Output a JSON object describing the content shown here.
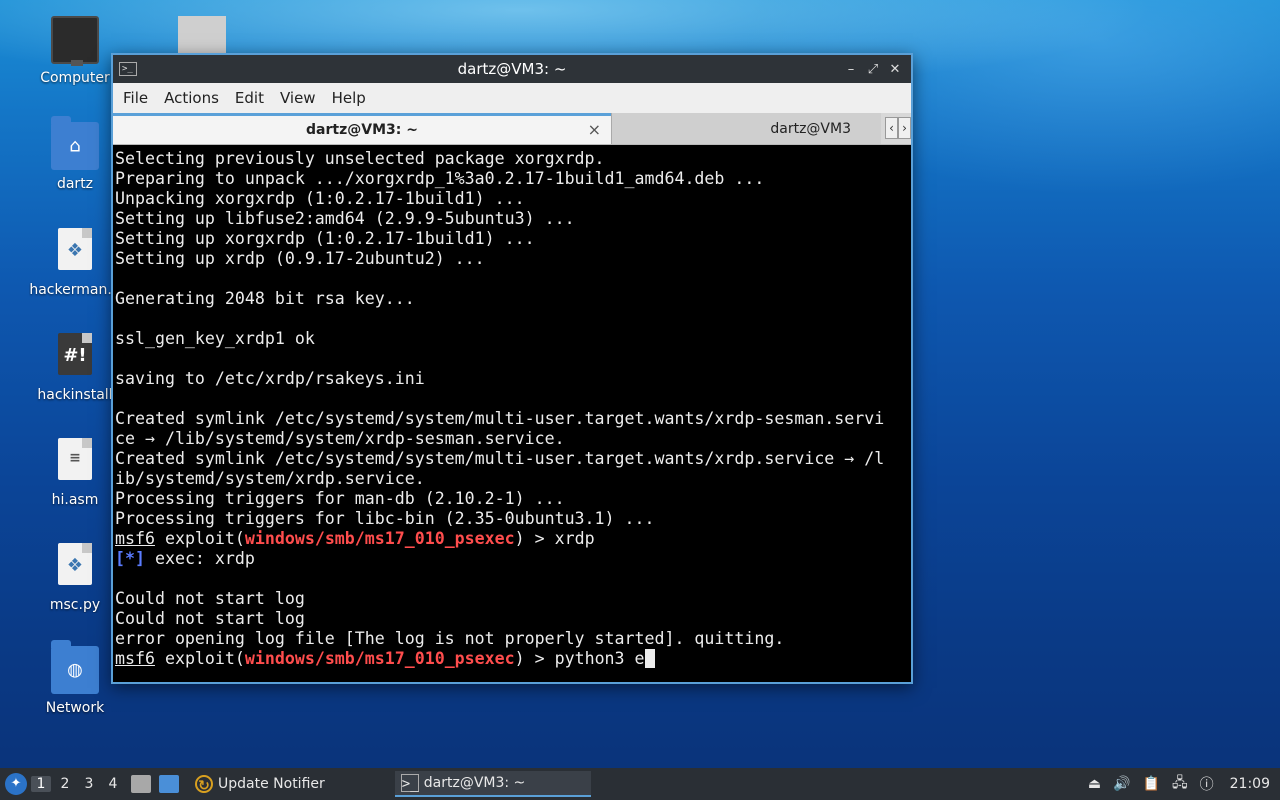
{
  "desktop": {
    "icons": [
      {
        "label": "Computer",
        "icon": "computer-icon"
      },
      {
        "label": "dartz",
        "icon": "home-folder-icon"
      },
      {
        "label": "hackerman.p",
        "icon": "python-file-icon"
      },
      {
        "label": "hackinstall",
        "icon": "script-file-icon"
      },
      {
        "label": "hi.asm",
        "icon": "text-file-icon"
      },
      {
        "label": "msc.py",
        "icon": "python-file-icon"
      },
      {
        "label": "Network",
        "icon": "network-folder-icon"
      }
    ]
  },
  "window": {
    "title": "dartz@VM3: ~",
    "menu": [
      "File",
      "Actions",
      "Edit",
      "View",
      "Help"
    ],
    "tabs": [
      {
        "label": "dartz@VM3: ~",
        "active": true
      },
      {
        "label": "dartz@VM3",
        "active": false
      }
    ],
    "terminal": {
      "lines": [
        "Selecting previously unselected package xorgxrdp.",
        "Preparing to unpack .../xorgxrdp_1%3a0.2.17-1build1_amd64.deb ...",
        "Unpacking xorgxrdp (1:0.2.17-1build1) ...",
        "Setting up libfuse2:amd64 (2.9.9-5ubuntu3) ...",
        "Setting up xorgxrdp (1:0.2.17-1build1) ...",
        "Setting up xrdp (0.9.17-2ubuntu2) ...",
        "",
        "Generating 2048 bit rsa key...",
        "",
        "ssl_gen_key_xrdp1 ok",
        "",
        "saving to /etc/xrdp/rsakeys.ini",
        "",
        "Created symlink /etc/systemd/system/multi-user.target.wants/xrdp-sesman.servi",
        "ce → /lib/systemd/system/xrdp-sesman.service.",
        "Created symlink /etc/systemd/system/multi-user.target.wants/xrdp.service → /l",
        "ib/systemd/system/xrdp.service.",
        "Processing triggers for man-db (2.10.2-1) ...",
        "Processing triggers for libc-bin (2.35-0ubuntu3.1) ..."
      ],
      "prompt1": {
        "msf": "msf6",
        "pre": " exploit(",
        "module": "windows/smb/ms17_010_psexec",
        "post": ") > ",
        "cmd": "xrdp"
      },
      "info_tag": "[*]",
      "info_text": " exec: xrdp",
      "lines2": [
        "",
        "Could not start log",
        "Could not start log",
        "error opening log file [The log is not properly started]. quitting."
      ],
      "prompt2": {
        "msf": "msf6",
        "pre": " exploit(",
        "module": "windows/smb/ms17_010_psexec",
        "post": ") > ",
        "cmd": "python3 e"
      }
    }
  },
  "taskbar": {
    "workspaces": [
      "1",
      "2",
      "3",
      "4"
    ],
    "tasks": [
      {
        "label": "Update Notifier",
        "icon": "update-notifier-icon"
      },
      {
        "label": "dartz@VM3: ~",
        "icon": "terminal-icon"
      }
    ],
    "clock": "21:09"
  }
}
